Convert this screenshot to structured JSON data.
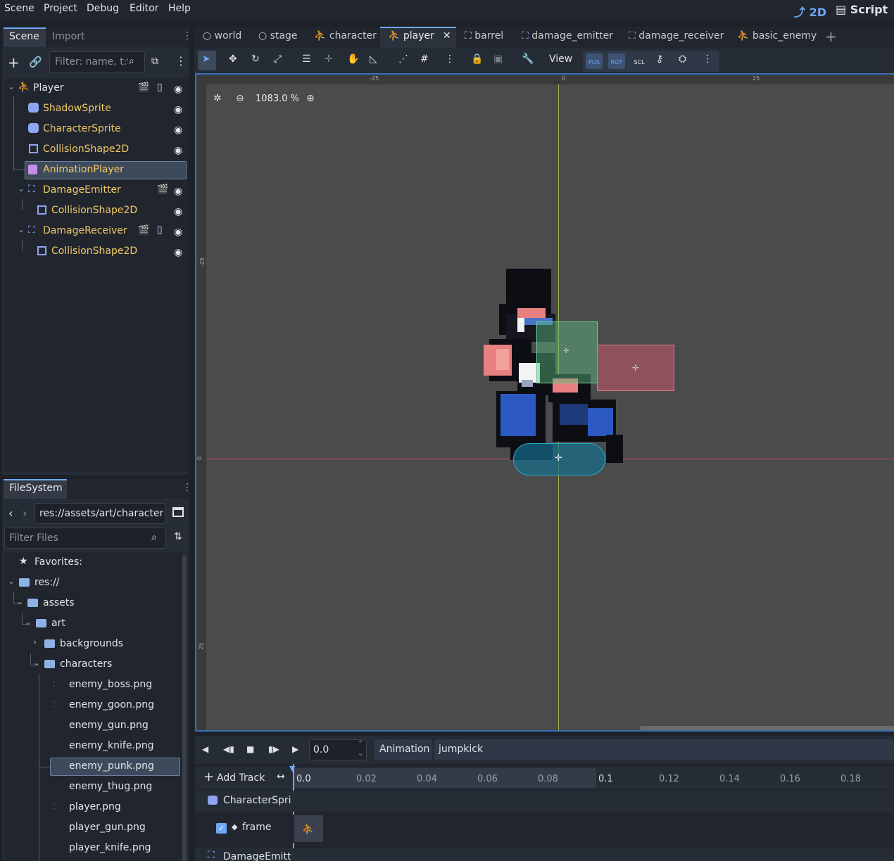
{
  "menu": [
    "Scene",
    "Project",
    "Debug",
    "Editor",
    "Help"
  ],
  "modes": {
    "two_d": "2D",
    "script": "Script"
  },
  "scene_dock": {
    "tabs": [
      "Scene",
      "Import"
    ],
    "filter_placeholder": "Filter: name, t:t",
    "tree": [
      {
        "label": "Player",
        "icon": "character-body-icon"
      },
      {
        "label": "ShadowSprite",
        "icon": "sprite-icon"
      },
      {
        "label": "CharacterSprite",
        "icon": "sprite-icon"
      },
      {
        "label": "CollisionShape2D",
        "icon": "collision-shape-icon"
      },
      {
        "label": "AnimationPlayer",
        "icon": "animation-player-icon"
      },
      {
        "label": "DamageEmitter",
        "icon": "area-icon"
      },
      {
        "label": "CollisionShape2D",
        "icon": "collision-shape-icon"
      },
      {
        "label": "DamageReceiver",
        "icon": "area-icon"
      },
      {
        "label": "CollisionShape2D",
        "icon": "collision-shape-icon"
      }
    ]
  },
  "filesystem": {
    "title": "FileSystem",
    "path": "res://assets/art/characters",
    "filter_placeholder": "Filter Files",
    "items": [
      {
        "label": "Favorites:"
      },
      {
        "label": "res://"
      },
      {
        "label": "assets"
      },
      {
        "label": "art"
      },
      {
        "label": "backgrounds"
      },
      {
        "label": "characters"
      },
      {
        "label": "enemy_boss.png"
      },
      {
        "label": "enemy_goon.png"
      },
      {
        "label": "enemy_gun.png"
      },
      {
        "label": "enemy_knife.png"
      },
      {
        "label": "enemy_punk.png"
      },
      {
        "label": "enemy_thug.png"
      },
      {
        "label": "player.png"
      },
      {
        "label": "player_gun.png"
      },
      {
        "label": "player_knife.png"
      }
    ]
  },
  "scene_tabs": [
    "world",
    "stage",
    "character",
    "player",
    "barrel",
    "damage_emitter",
    "damage_receiver",
    "basic_enemy"
  ],
  "toolbar": {
    "view_label": "View",
    "pos": "POS",
    "rot": "ROT",
    "scl": "SCL"
  },
  "viewport": {
    "zoom": "1083.0 %",
    "ruler_top": [
      "-25",
      "0",
      "25"
    ],
    "ruler_left": [
      "-25",
      "0",
      "25"
    ]
  },
  "animation": {
    "time_value": "0.0",
    "animation_label": "Animation",
    "animation_name": "jumpkick",
    "add_track": "Add Track",
    "ticks": [
      "0.0",
      "0.02",
      "0.04",
      "0.06",
      "0.08",
      "0.1",
      "0.12",
      "0.14",
      "0.16",
      "0.18"
    ],
    "tracks": [
      {
        "label": "CharacterSprit"
      },
      {
        "label": "frame"
      },
      {
        "label": "DamageEmitte"
      }
    ]
  },
  "colors": {
    "accent": "#6fa8f5",
    "node_label": "#f2c867",
    "selected": "#3d4a5c"
  }
}
